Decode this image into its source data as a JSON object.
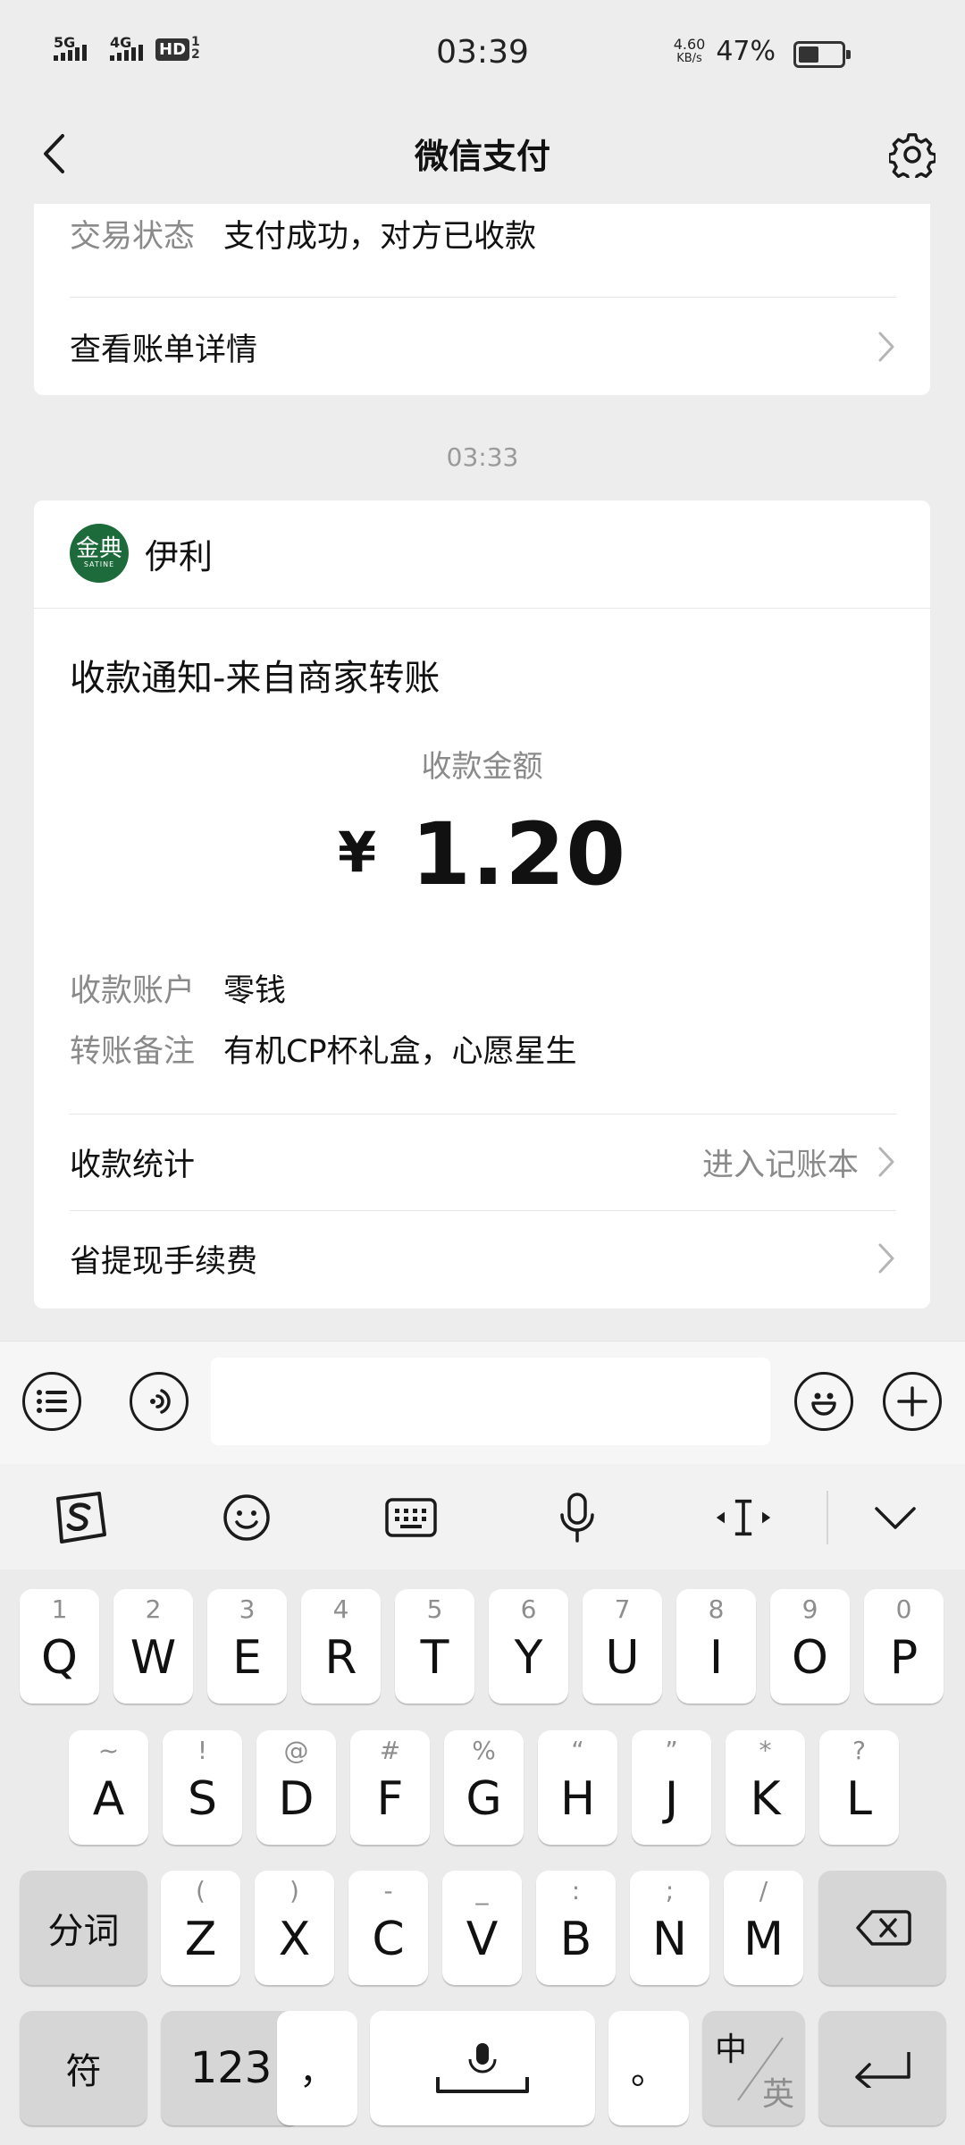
{
  "status_bar": {
    "signal1": "5G",
    "signal2": "4G",
    "hd": "HD",
    "hd_sub1": "1",
    "hd_sub2": "2",
    "time": "03:39",
    "speed_value": "4.60",
    "speed_unit": "KB/s",
    "battery_pct": "47%",
    "battery_level": 0.47
  },
  "nav": {
    "title": "微信支付",
    "back_icon": "chevron-left-icon",
    "settings_icon": "gear-icon"
  },
  "card1": {
    "status_label": "交易状态",
    "status_value": "支付成功，对方已收款",
    "bill_link": "查看账单详情"
  },
  "timestamp": "03:33",
  "card2": {
    "logo_text": "金典",
    "logo_sub": "SATINE",
    "merchant": "伊利",
    "title": "收款通知-来自商家转账",
    "amount_label": "收款金额",
    "currency": "¥",
    "amount": "1.20",
    "account_label": "收款账户",
    "account_value": "零钱",
    "remark_label": "转账备注",
    "remark_value": "有机CP杯礼盒，心愿星生",
    "stats_label": "收款统计",
    "stats_link": "进入记账本",
    "fee_label": "省提现手续费"
  },
  "input_bar": {
    "left_icons": [
      "list-icon",
      "voice-icon"
    ],
    "right_icons": [
      "emoji-icon",
      "plus-icon"
    ],
    "value": ""
  },
  "keyboard": {
    "toolbar_icons": [
      "sogou-logo-icon",
      "emoji-icon",
      "keyboard-icon",
      "microphone-icon",
      "cursor-move-icon",
      "collapse-chevron-icon"
    ],
    "row1": [
      {
        "main": "Q",
        "hint": "1"
      },
      {
        "main": "W",
        "hint": "2"
      },
      {
        "main": "E",
        "hint": "3"
      },
      {
        "main": "R",
        "hint": "4"
      },
      {
        "main": "T",
        "hint": "5"
      },
      {
        "main": "Y",
        "hint": "6"
      },
      {
        "main": "U",
        "hint": "7"
      },
      {
        "main": "I",
        "hint": "8"
      },
      {
        "main": "O",
        "hint": "9"
      },
      {
        "main": "P",
        "hint": "0"
      }
    ],
    "row2": [
      {
        "main": "A",
        "hint": "~"
      },
      {
        "main": "S",
        "hint": "!"
      },
      {
        "main": "D",
        "hint": "@"
      },
      {
        "main": "F",
        "hint": "#"
      },
      {
        "main": "G",
        "hint": "%"
      },
      {
        "main": "H",
        "hint": "“"
      },
      {
        "main": "J",
        "hint": "”"
      },
      {
        "main": "K",
        "hint": "*"
      },
      {
        "main": "L",
        "hint": "?"
      }
    ],
    "row3": [
      {
        "main": "Z",
        "hint": "("
      },
      {
        "main": "X",
        "hint": ")"
      },
      {
        "main": "C",
        "hint": "-"
      },
      {
        "main": "V",
        "hint": "_"
      },
      {
        "main": "B",
        "hint": ":"
      },
      {
        "main": "N",
        "hint": ";"
      },
      {
        "main": "M",
        "hint": "/"
      }
    ],
    "segment_key": "分词",
    "symbol_key": "符",
    "num_key": "123",
    "comma_key": "，",
    "period_key": "。",
    "lang_top": "中",
    "lang_bottom": "英"
  }
}
